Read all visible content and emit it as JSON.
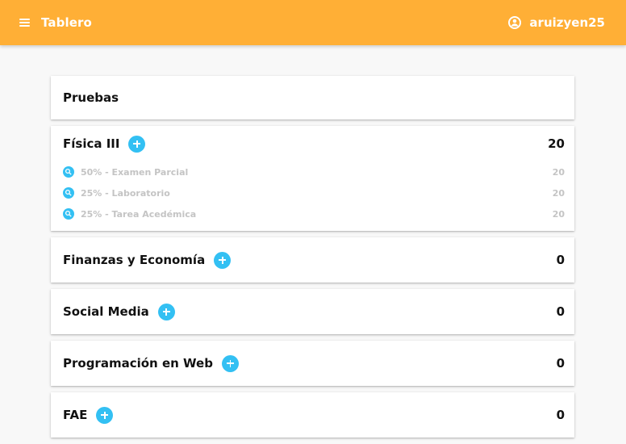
{
  "header": {
    "title": "Tablero",
    "username": "aruizyen25"
  },
  "main": {
    "section_title": "Pruebas",
    "courses": [
      {
        "name": "Física III",
        "score": "20",
        "evaluations": [
          {
            "label": "50% - Examen Parcial",
            "score": "20"
          },
          {
            "label": "25% - Laboratorio",
            "score": "20"
          },
          {
            "label": "25% - Tarea Acedémica",
            "score": "20"
          }
        ]
      },
      {
        "name": "Finanzas y Economía",
        "score": "0"
      },
      {
        "name": "Social Media",
        "score": "0"
      },
      {
        "name": "Programación en Web",
        "score": "0"
      },
      {
        "name": "FAE",
        "score": "0"
      }
    ]
  },
  "colors": {
    "header_bg": "#ffaf36",
    "accent": "#33c0f3"
  },
  "icons": {
    "menu": "menu-icon",
    "user": "account-circle-icon",
    "add": "plus-icon",
    "search": "search-icon"
  }
}
